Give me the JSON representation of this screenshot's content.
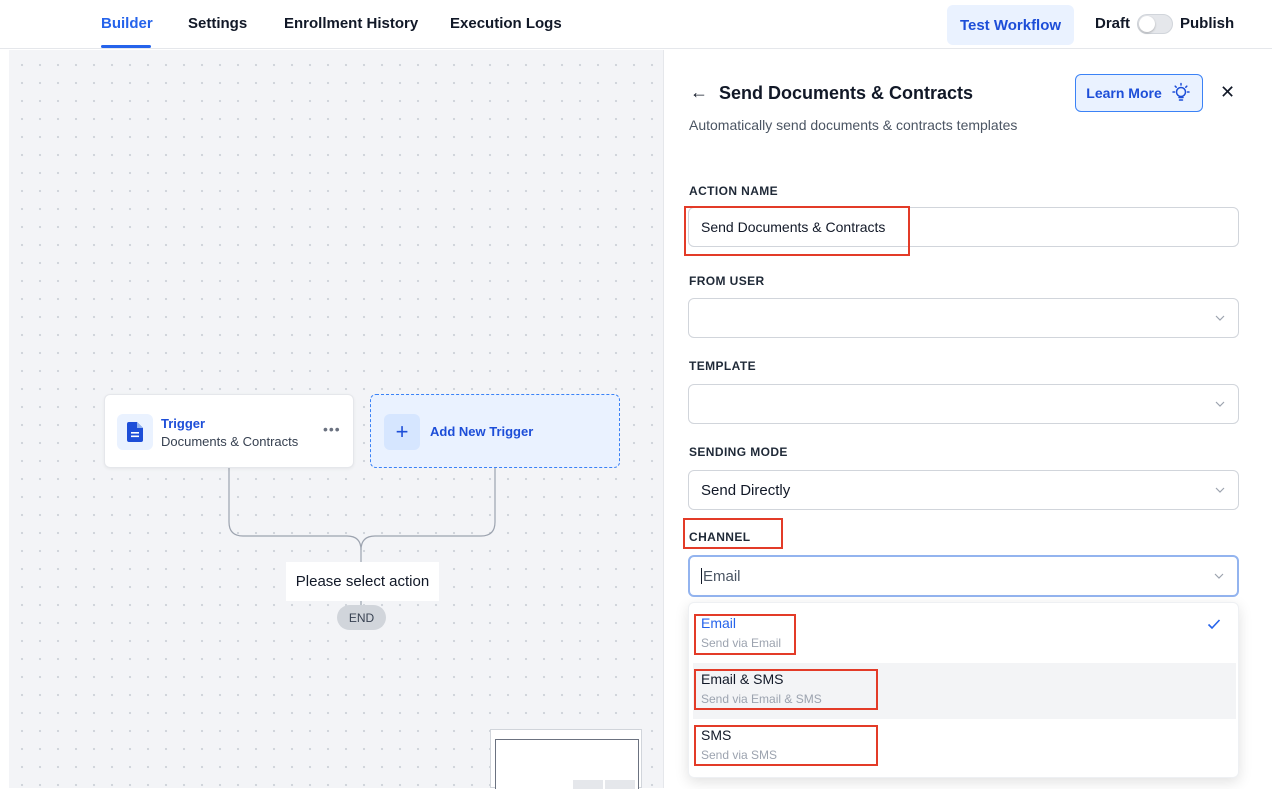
{
  "nav": {
    "tabs": [
      {
        "label": "Builder",
        "active": true
      },
      {
        "label": "Settings",
        "active": false
      },
      {
        "label": "Enrollment History",
        "active": false
      },
      {
        "label": "Execution Logs",
        "active": false
      }
    ],
    "test_button": "Test Workflow",
    "draft_label": "Draft",
    "publish_label": "Publish",
    "publish_toggle_on": false
  },
  "canvas": {
    "trigger_node": {
      "title": "Trigger",
      "subtitle": "Documents & Contracts",
      "icon": "document-icon"
    },
    "add_trigger": {
      "label": "Add New Trigger",
      "icon": "plus-icon"
    },
    "action_placeholder": "Please select action",
    "end_label": "END"
  },
  "panel": {
    "title": "Send Documents & Contracts",
    "description": "Automatically send documents & contracts templates",
    "learn_more": "Learn More",
    "fields": {
      "action_name": {
        "label": "ACTION NAME",
        "value": "Send Documents & Contracts"
      },
      "from_user": {
        "label": "FROM USER",
        "value": ""
      },
      "template": {
        "label": "TEMPLATE",
        "value": ""
      },
      "sending_mode": {
        "label": "SENDING MODE",
        "value": "Send Directly"
      },
      "channel": {
        "label": "CHANNEL",
        "value": "Email"
      }
    },
    "channel_options": [
      {
        "title": "Email",
        "subtitle": "Send via Email",
        "selected": true
      },
      {
        "title": "Email & SMS",
        "subtitle": "Send via Email & SMS",
        "selected": false
      },
      {
        "title": "SMS",
        "subtitle": "Send via SMS",
        "selected": false
      }
    ]
  },
  "colors": {
    "accent": "#2563eb",
    "highlight": "#e33b28",
    "canvas_bg": "#f3f4f7"
  }
}
